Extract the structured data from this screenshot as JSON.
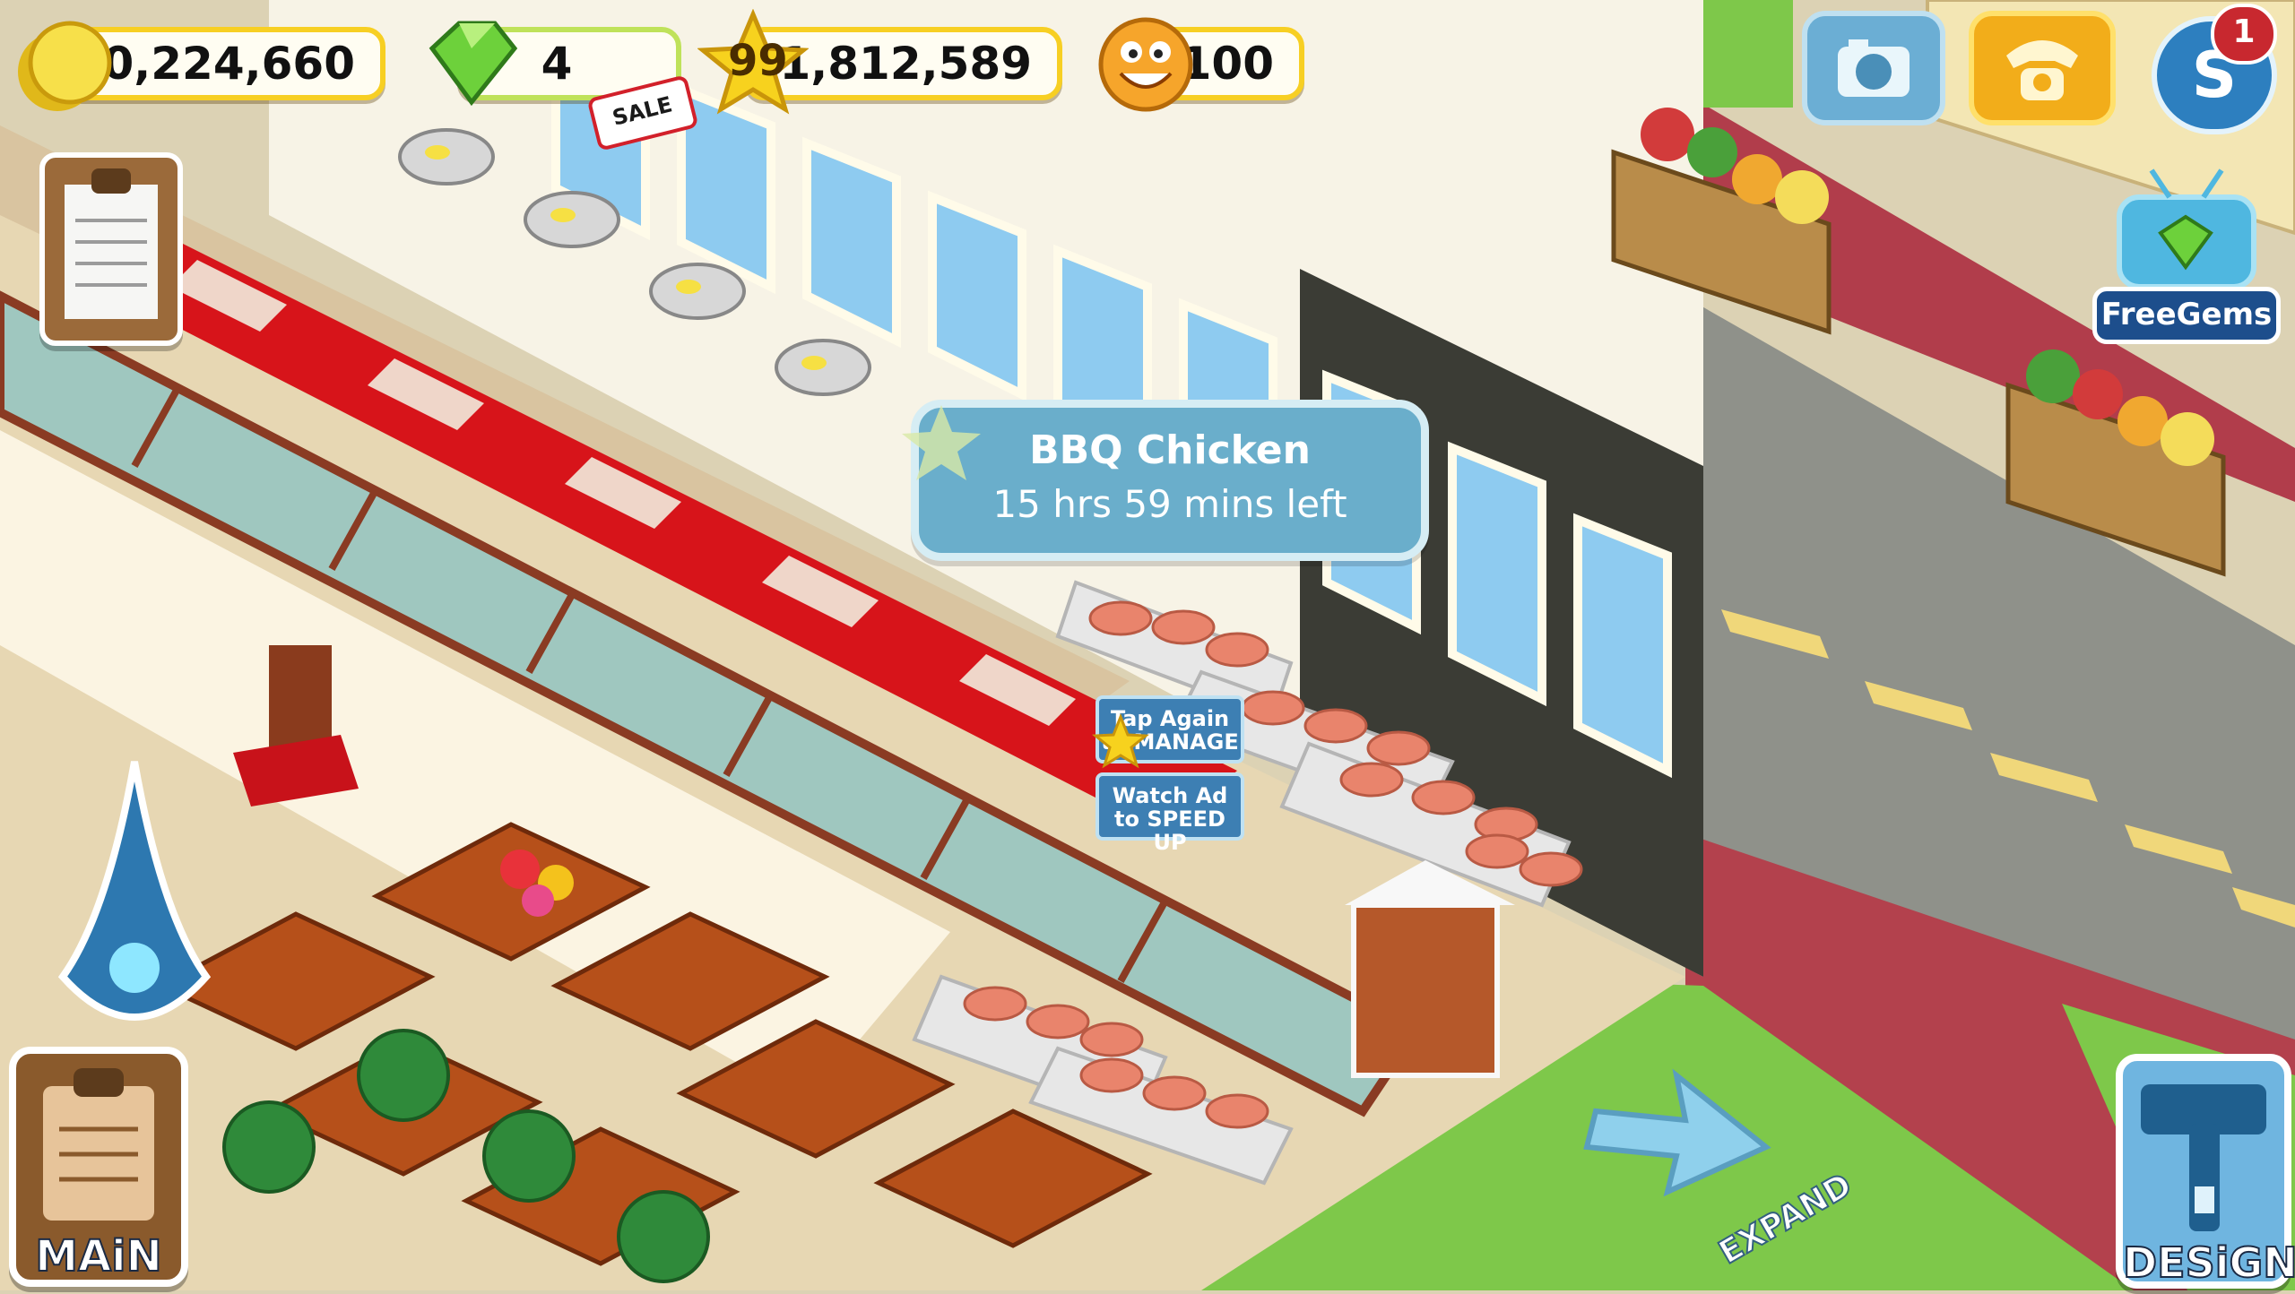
{
  "hud": {
    "coins": "30,224,660",
    "gems": "4",
    "sale_tag": "SALE",
    "star_level": "99",
    "star_points": "1,812,589",
    "happiness": "100"
  },
  "corner_buttons": {
    "camera": "camera-icon",
    "phone": "phone-icon",
    "social_badge": "1",
    "free_gems_label": "FreeGems"
  },
  "tooltip": {
    "dish_name": "BBQ Chicken",
    "time_left": "15 hrs 59 mins left"
  },
  "stove_actions": {
    "tap_again": "Tap Again to MANAGE",
    "watch_ad": "Watch Ad to SPEED UP"
  },
  "bottom": {
    "main_label": "MAiN",
    "design_label": "DESiGN",
    "expand_label": "EXPAND"
  },
  "colors": {
    "grass": "#7ec84a",
    "road": "#8f918a",
    "sidewalk": "#b5414f",
    "counter_red": "#d7141a",
    "hud_gold": "#f7cf23",
    "tooltip_blue": "#6aaecb"
  }
}
